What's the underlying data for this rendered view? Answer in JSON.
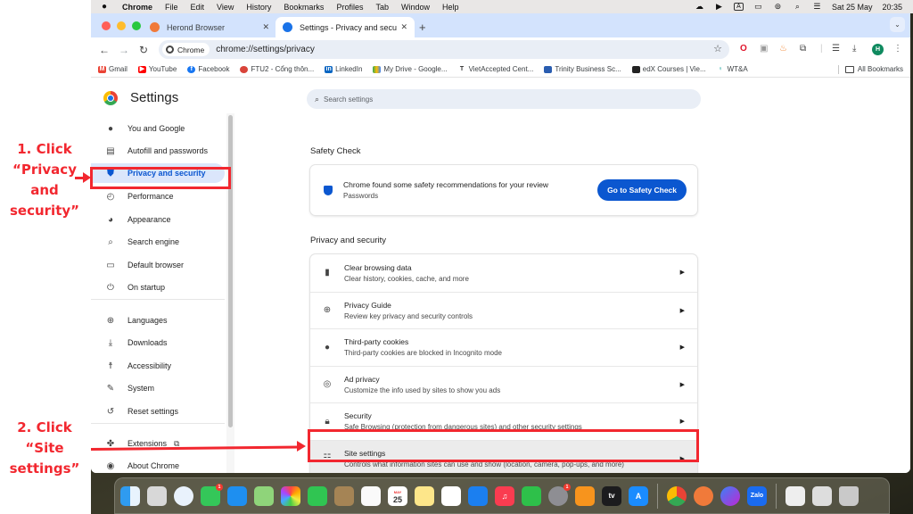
{
  "annotations": {
    "step1": "1. Click “Privacy and security”",
    "step1_lines": [
      "1. Click",
      "“Privacy",
      "and",
      "security”"
    ],
    "step2_lines": [
      "2.  Click",
      "“Site",
      "settings”"
    ],
    "color": "#f2272f"
  },
  "menubar": {
    "app": "Chrome",
    "items": [
      "File",
      "Edit",
      "View",
      "History",
      "Bookmarks",
      "Profiles",
      "Tab",
      "Window",
      "Help"
    ],
    "date": "Sat 25 May",
    "time": "20:35",
    "input_indicator": "A"
  },
  "tabs": [
    {
      "title": "Herond Browser",
      "active": false
    },
    {
      "title": "Settings - Privacy and securit",
      "active": true
    }
  ],
  "toolbar": {
    "chip_label": "Chrome",
    "url": "chrome://settings/privacy",
    "profile_initial": "H"
  },
  "bookmarks": [
    {
      "label": "Gmail",
      "color": "#ea4335"
    },
    {
      "label": "YouTube",
      "color": "#ff0000"
    },
    {
      "label": "Facebook",
      "color": "#1877f2"
    },
    {
      "label": "FTU2 - Cổng thôn...",
      "color": "#d9443a"
    },
    {
      "label": "LinkedIn",
      "color": "#0a66c2"
    },
    {
      "label": "My Drive - Google...",
      "color": "#34a853"
    },
    {
      "label": "VietAccepted Cent...",
      "color": "#333333"
    },
    {
      "label": "Trinity Business Sc...",
      "color": "#2a5db0"
    },
    {
      "label": "edX Courses | Vie...",
      "color": "#222222"
    },
    {
      "label": "WT&A",
      "color": "#1fa7a0"
    }
  ],
  "all_bookmarks": "All Bookmarks",
  "settings": {
    "title": "Settings",
    "search_placeholder": "Search settings",
    "sidebar": [
      {
        "label": "You and Google",
        "icon": "person-icon"
      },
      {
        "label": "Autofill and passwords",
        "icon": "clipboard-icon"
      },
      {
        "label": "Privacy and security",
        "icon": "shield-icon",
        "active": true
      },
      {
        "label": "Performance",
        "icon": "gauge-icon"
      },
      {
        "label": "Appearance",
        "icon": "palette-icon"
      },
      {
        "label": "Search engine",
        "icon": "search-icon"
      },
      {
        "label": "Default browser",
        "icon": "browser-icon"
      },
      {
        "label": "On startup",
        "icon": "power-icon"
      },
      {
        "label": "Languages",
        "icon": "globe-icon"
      },
      {
        "label": "Downloads",
        "icon": "download-icon"
      },
      {
        "label": "Accessibility",
        "icon": "accessibility-icon"
      },
      {
        "label": "System",
        "icon": "wrench-icon"
      },
      {
        "label": "Reset settings",
        "icon": "history-icon"
      },
      {
        "label": "Extensions",
        "icon": "puzzle-icon"
      },
      {
        "label": "About Chrome",
        "icon": "chrome-icon"
      }
    ],
    "safety_check": {
      "heading": "Safety Check",
      "message": "Chrome found some safety recommendations for your review",
      "sub": "Passwords",
      "button": "Go to Safety Check"
    },
    "privacy_heading": "Privacy and security",
    "privacy_rows": [
      {
        "title": "Clear browsing data",
        "sub": "Clear history, cookies, cache, and more",
        "icon": "trash-icon"
      },
      {
        "title": "Privacy Guide",
        "sub": "Review key privacy and security controls",
        "icon": "compass-icon"
      },
      {
        "title": "Third-party cookies",
        "sub": "Third-party cookies are blocked in Incognito mode",
        "icon": "cookie-icon"
      },
      {
        "title": "Ad privacy",
        "sub": "Customize the info used by sites to show you ads",
        "icon": "ad-privacy-icon"
      },
      {
        "title": "Security",
        "sub": "Safe Browsing (protection from dangerous sites) and other security settings",
        "icon": "lock-icon"
      },
      {
        "title": "Site settings",
        "sub": "Controls what information sites can use and show (location, camera, pop-ups, and more)",
        "icon": "sliders-icon"
      }
    ]
  },
  "dock": {
    "apps": [
      "Finder",
      "Launchpad",
      "Safari",
      "Messages",
      "Mail",
      "Maps",
      "Photos",
      "FaceTime",
      "Contacts",
      "Reminders",
      "Calendar",
      "Notes",
      "Freeform",
      "Keynote",
      "Music",
      "Numbers",
      "System Settings",
      "Pages",
      "TV",
      "App Store",
      "Chrome",
      "Herond",
      "Messenger",
      "Zalo",
      "Preview",
      "Document",
      "Trash"
    ],
    "calendar_day": "25",
    "calendar_month": "MAY",
    "messages_badge": "1",
    "settings_badge": "1",
    "tv_label": "tv",
    "zalo_label": "Zalo"
  }
}
